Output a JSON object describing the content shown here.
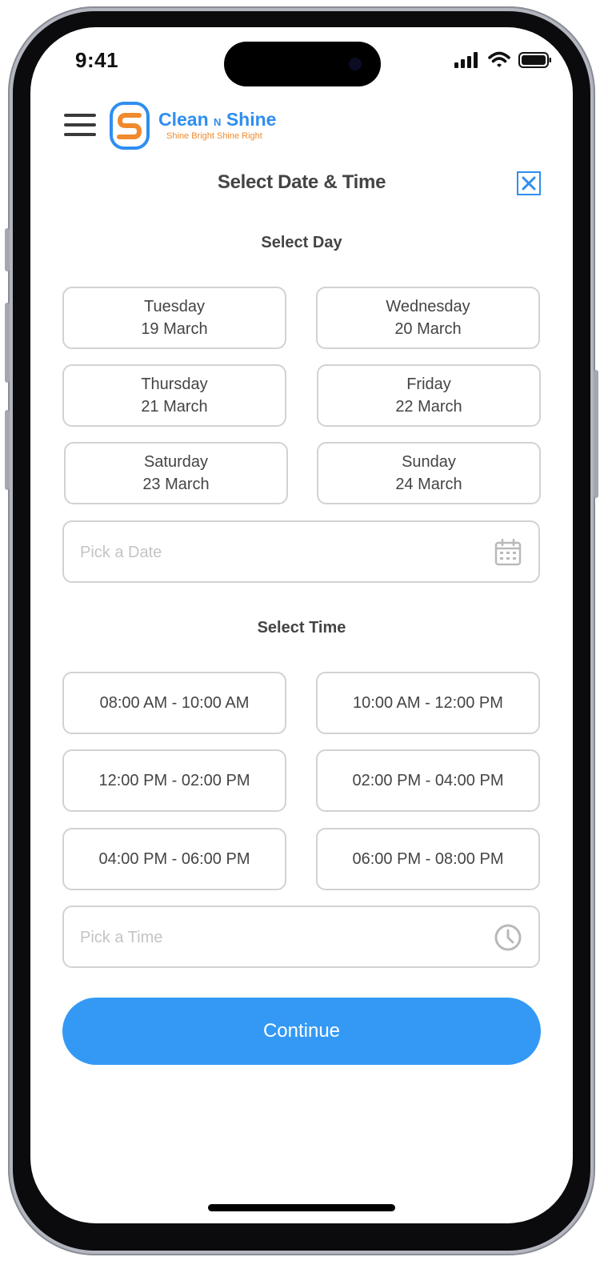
{
  "status_bar": {
    "time": "9:41"
  },
  "header": {
    "brand_name": "Clean",
    "brand_connector": "N",
    "brand_name_2": "Shine",
    "tagline": "Shine Bright Shine Right",
    "logo_letter": "S"
  },
  "dialog": {
    "title": "Select Date & Time",
    "day_section_label": "Select Day",
    "days": [
      {
        "weekday": "Tuesday",
        "date": "19 March"
      },
      {
        "weekday": "Wednesday",
        "date": "20 March"
      },
      {
        "weekday": "Thursday",
        "date": "21 March"
      },
      {
        "weekday": "Friday",
        "date": "22 March"
      },
      {
        "weekday": "Saturday",
        "date": "23 March"
      },
      {
        "weekday": "Sunday",
        "date": "24 March"
      }
    ],
    "date_input": {
      "placeholder": "Pick a Date",
      "value": ""
    },
    "time_section_label": "Select Time",
    "time_slots": [
      "08:00 AM - 10:00 AM",
      "10:00 AM - 12:00 PM",
      "12:00 PM - 02:00 PM",
      "02:00 PM - 04:00 PM",
      "04:00 PM - 06:00 PM",
      "06:00 PM - 08:00 PM"
    ],
    "time_input": {
      "placeholder": "Pick a Time",
      "value": ""
    },
    "continue_label": "Continue"
  },
  "colors": {
    "accent": "#3399f5",
    "brand_blue": "#2f8ef0",
    "brand_orange": "#f08a2c",
    "text": "#444444",
    "border": "#d2d2d2",
    "placeholder": "#c4c4c4"
  },
  "icons": {
    "menu": "hamburger-menu-icon",
    "close": "close-icon",
    "calendar": "calendar-icon",
    "clock": "clock-icon"
  }
}
